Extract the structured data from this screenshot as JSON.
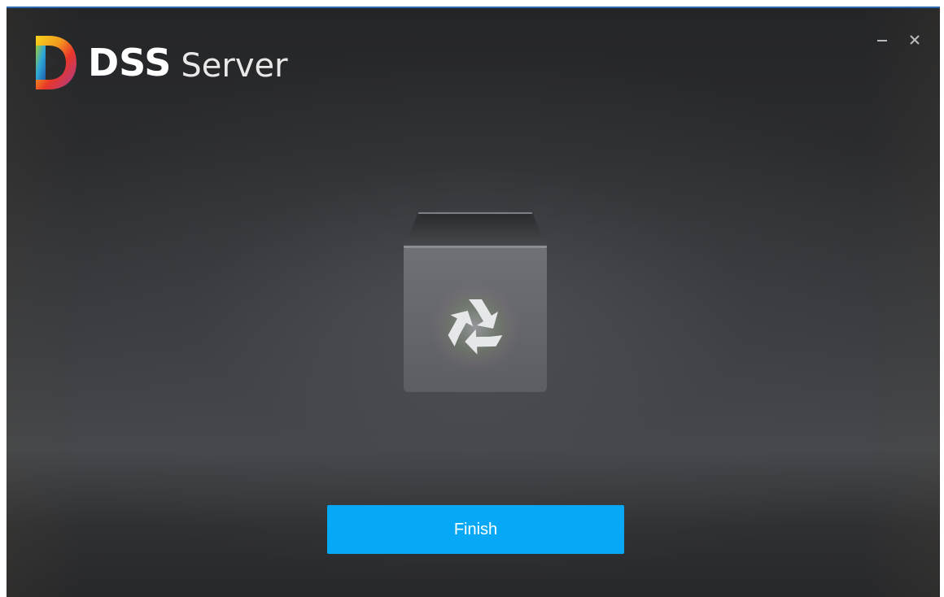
{
  "app": {
    "brand_name": "DSS",
    "product_name": "Server"
  },
  "window_controls": {
    "minimize_icon": "minimize-icon",
    "close_icon": "close-icon"
  },
  "illustration": {
    "icon": "recycle-bin-icon"
  },
  "actions": {
    "finish_label": "Finish"
  },
  "colors": {
    "accent": "#07a9f6",
    "title_border": "#2a6ab3",
    "background_dark": "#242527"
  }
}
